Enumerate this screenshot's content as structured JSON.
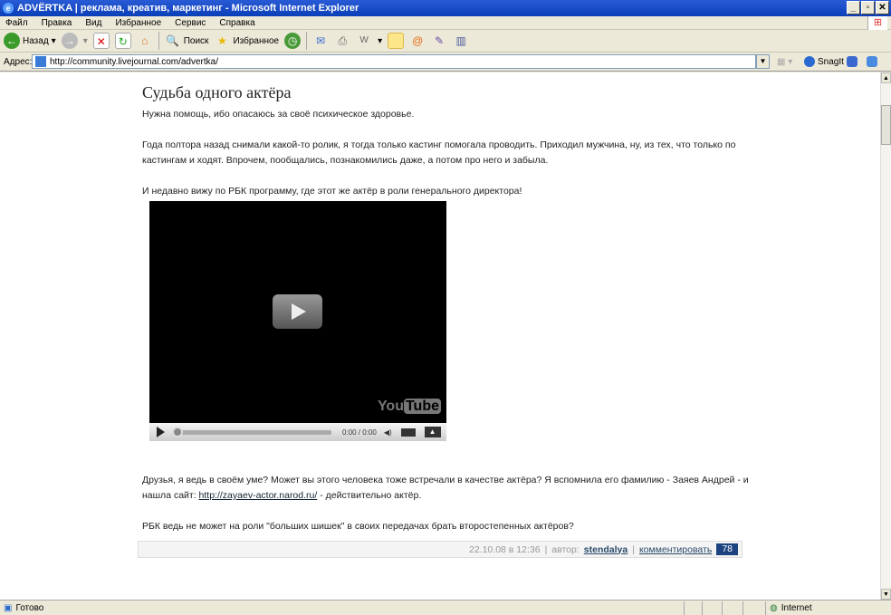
{
  "window": {
    "title": "ADVЁRTKA | реклама, креатив, маркетинг - Microsoft Internet Explorer",
    "min": "_",
    "max": "▫",
    "close": "✕"
  },
  "menu": [
    "Файл",
    "Правка",
    "Вид",
    "Избранное",
    "Сервис",
    "Справка"
  ],
  "toolbar": {
    "back": "Назад",
    "search": "Поиск",
    "favorites": "Избранное",
    "snagit": "SnagIt"
  },
  "address": {
    "label": "Адрес:",
    "url": "http://community.livejournal.com/advertka/"
  },
  "post": {
    "title": "Судьба одного актёра",
    "p1": "Нужна помощь, ибо опасаюсь за своё психическое здоровье.",
    "p2": "Года полтора назад снимали какой-то ролик, я тогда только кастинг помогала проводить. Приходил мужчина, ну, из тех, что только по кастингам и ходят. Впрочем, пообщались, познакомились даже, а потом про него и забыла.",
    "p3": "И недавно вижу по РБК программу, где этот же актёр в роли генерального директора!",
    "p4a": "Друзья, я ведь в своём уме? Может вы этого человека тоже встречали в качестве актёра? Я вспомнила его фамилию - Заяев Андрей - и нашла сайт: ",
    "link": "http://zayaev-actor.narod.ru/",
    "p4b": " - действительно актёр.",
    "p5": "РБК ведь не может на роли \"больших шишек\" в своих передачах брать второстепенных актёров?"
  },
  "video": {
    "time": "0:00 / 0:00",
    "logo_you": "You",
    "logo_tube": "Tube"
  },
  "footer": {
    "date": "22.10.08 в 12:36",
    "sep": "|",
    "author_label": "автор:",
    "author": "stendalya",
    "comment": "комментировать",
    "count": "78"
  },
  "status": {
    "text": "Готово",
    "zone": "Internet"
  }
}
